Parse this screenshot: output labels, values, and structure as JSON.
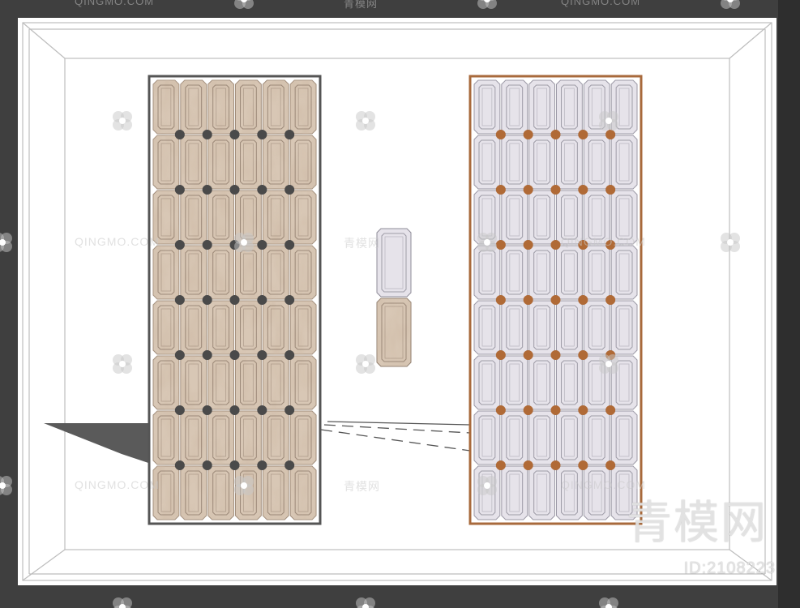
{
  "watermarks": {
    "brand_latin": "QINGMO.COM",
    "brand_cn": "青模网",
    "big_cn": "青模网",
    "id_text": "ID:2108223"
  },
  "colors": {
    "frame": "#3f3f3f",
    "room": "#ffffff",
    "left_frame": "#555555",
    "left_tile": "#d8c7b5",
    "left_tile_vein": "#b8977a",
    "left_dot": "#4a4a4a",
    "right_frame": "#a86a3c",
    "right_tile": "#e6e3ea",
    "right_dot": "#b06a36"
  },
  "icons": [
    "watermark-logo-icon"
  ],
  "panels": {
    "left": {
      "columns": 6,
      "rows": 8,
      "material": "marble"
    },
    "right": {
      "columns": 6,
      "rows": 8,
      "material": "white lacquer"
    },
    "samples": 2
  }
}
